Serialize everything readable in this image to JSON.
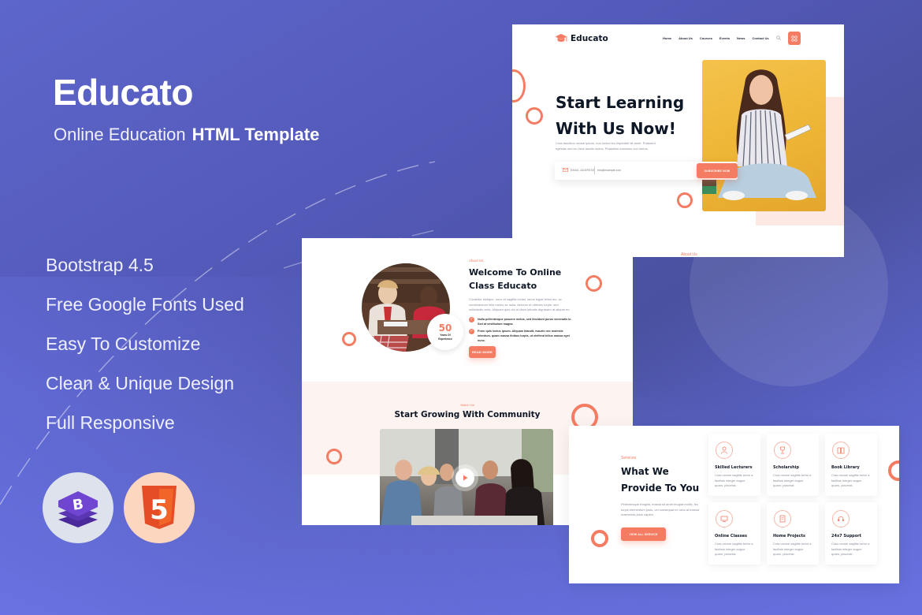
{
  "promo": {
    "title": "Educato",
    "subtitle_light": "Online Education",
    "subtitle_bold": "HTML Template",
    "features": [
      "Bootstrap 4.5",
      "Free Google Fonts Used",
      "Easy To Customize",
      "Clean & Unique Design",
      "Full Responsive"
    ],
    "badges": [
      {
        "name": "bootstrap",
        "glyph": "B"
      },
      {
        "name": "html5",
        "glyph": "5"
      }
    ]
  },
  "colors": {
    "accent": "#f47c62",
    "background_start": "#5d66cb",
    "background_end": "#6770df",
    "heading": "#0e1726",
    "blush": "#fde8e3"
  },
  "hero_page": {
    "logo": "Educato",
    "nav": [
      "Home",
      "About Us",
      "Courses",
      "Events",
      "News",
      "Contact Us"
    ],
    "title_line1": "Start Learning",
    "title_line2": "With Us Now!",
    "description_line1": "Cras faucibus ornare ipsum, non luctus leo imperdiet sit amet. Praesent",
    "description_line2": "egestas sed eu risus iaculis luctus. Phasellus maximus orci metus.",
    "email_label": "EMAIL ADDRESS",
    "email_placeholder": "info@example.com",
    "subscribe_button": "SUBSCRIBE NOW",
    "next_section_peek": "About Us"
  },
  "about_page": {
    "eyebrow": "About Us",
    "title_line1": "Welcome To Online",
    "title_line2": "Class Educato",
    "description": "Curabitur tristique, nunc et sagittis luctus, lacus fugiat tellus leo, ac condimentum felis metus ac nulla. Aenean et ultricies turpis, sed sollicitudin eros. Aliquam quis dui ut diam lobortis dignissim at aliquet ex.",
    "checklist": [
      "Nulla pellentesque posuere metus, sed tincidunt purus venenatis in. Sed at vestibulum magna.",
      "Proin quis lectus ipsum. Aliquam blandit, mauris nec molestie interdum, quam massa finibus turpis, ut eleifend tellus massa eget nunc."
    ],
    "read_more_button": "READ MORE",
    "experience_number": "50",
    "experience_label_line1": "Years Of",
    "experience_label_line2": "Experience",
    "community_eyebrow": "Watch Us",
    "community_title": "Start Growing With Community"
  },
  "services_page": {
    "eyebrow": "Services",
    "title_line1": "What We",
    "title_line2": "Provide To You",
    "description": "Pellentesque fringilla, massa sit amet feugiat mollis, leo turpis elementum justo, vel consequat ex urna at massa maecenas justo sapien.",
    "button": "VIEW ALL SERVICE",
    "cards": [
      {
        "title": "Skilled Lecturers",
        "icon": "lecturer-icon",
        "text": "Cras ornare sagittis tortor a facilisis integer augue quam, placerat."
      },
      {
        "title": "Scholarship",
        "icon": "trophy-icon",
        "text": "Cras ornare sagittis tortor a facilisis integer augue quam, placerat."
      },
      {
        "title": "Book Library",
        "icon": "book-icon",
        "text": "Cras ornare sagittis tortor a facilisis integer augue quam, placerat."
      },
      {
        "title": "Online Classes",
        "icon": "online-class-icon",
        "text": "Cras ornare sagittis tortor a facilisis integer augue quam, placerat."
      },
      {
        "title": "Home Projects",
        "icon": "project-icon",
        "text": "Cras ornare sagittis tortor a facilisis integer augue quam, placerat."
      },
      {
        "title": "24x7 Support",
        "icon": "support-icon",
        "text": "Cras ornare sagittis tortor a facilisis integer augue quam, placerat."
      }
    ]
  }
}
